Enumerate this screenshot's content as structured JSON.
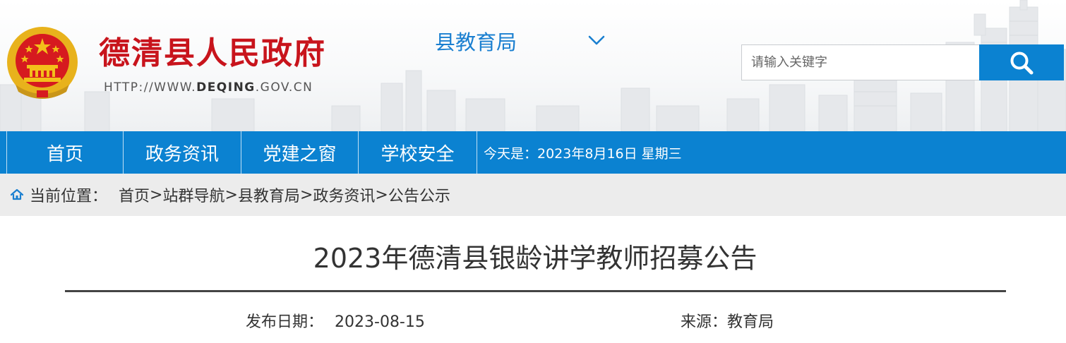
{
  "header": {
    "site_title": "德清县人民政府",
    "url_prefix": "HTTP://WWW.",
    "url_domain": "DEQING",
    "url_suffix": ".GOV.CN",
    "department": "县教育局",
    "search_placeholder": "请输入关键字"
  },
  "nav": {
    "items": [
      "首页",
      "政务资讯",
      "党建之窗",
      "学校安全"
    ],
    "today": "今天是：2023年8月16日 星期三"
  },
  "breadcrumb": {
    "label": "当前位置：",
    "items": [
      "首页",
      "站群导航",
      "县教育局",
      "政务资讯",
      "公告公示"
    ],
    "separator": ">"
  },
  "article": {
    "title": "2023年德清县银龄讲学教师招募公告",
    "date_label": "发布日期：",
    "date": "2023-08-15",
    "source_label": "来源：",
    "source": "教育局"
  },
  "colors": {
    "brand_blue": "#0b82d1",
    "title_red": "#c8141c",
    "emblem_gold": "#e8b21c"
  },
  "icons": [
    "national-emblem-icon",
    "chevron-down-icon",
    "search-icon",
    "home-icon"
  ]
}
